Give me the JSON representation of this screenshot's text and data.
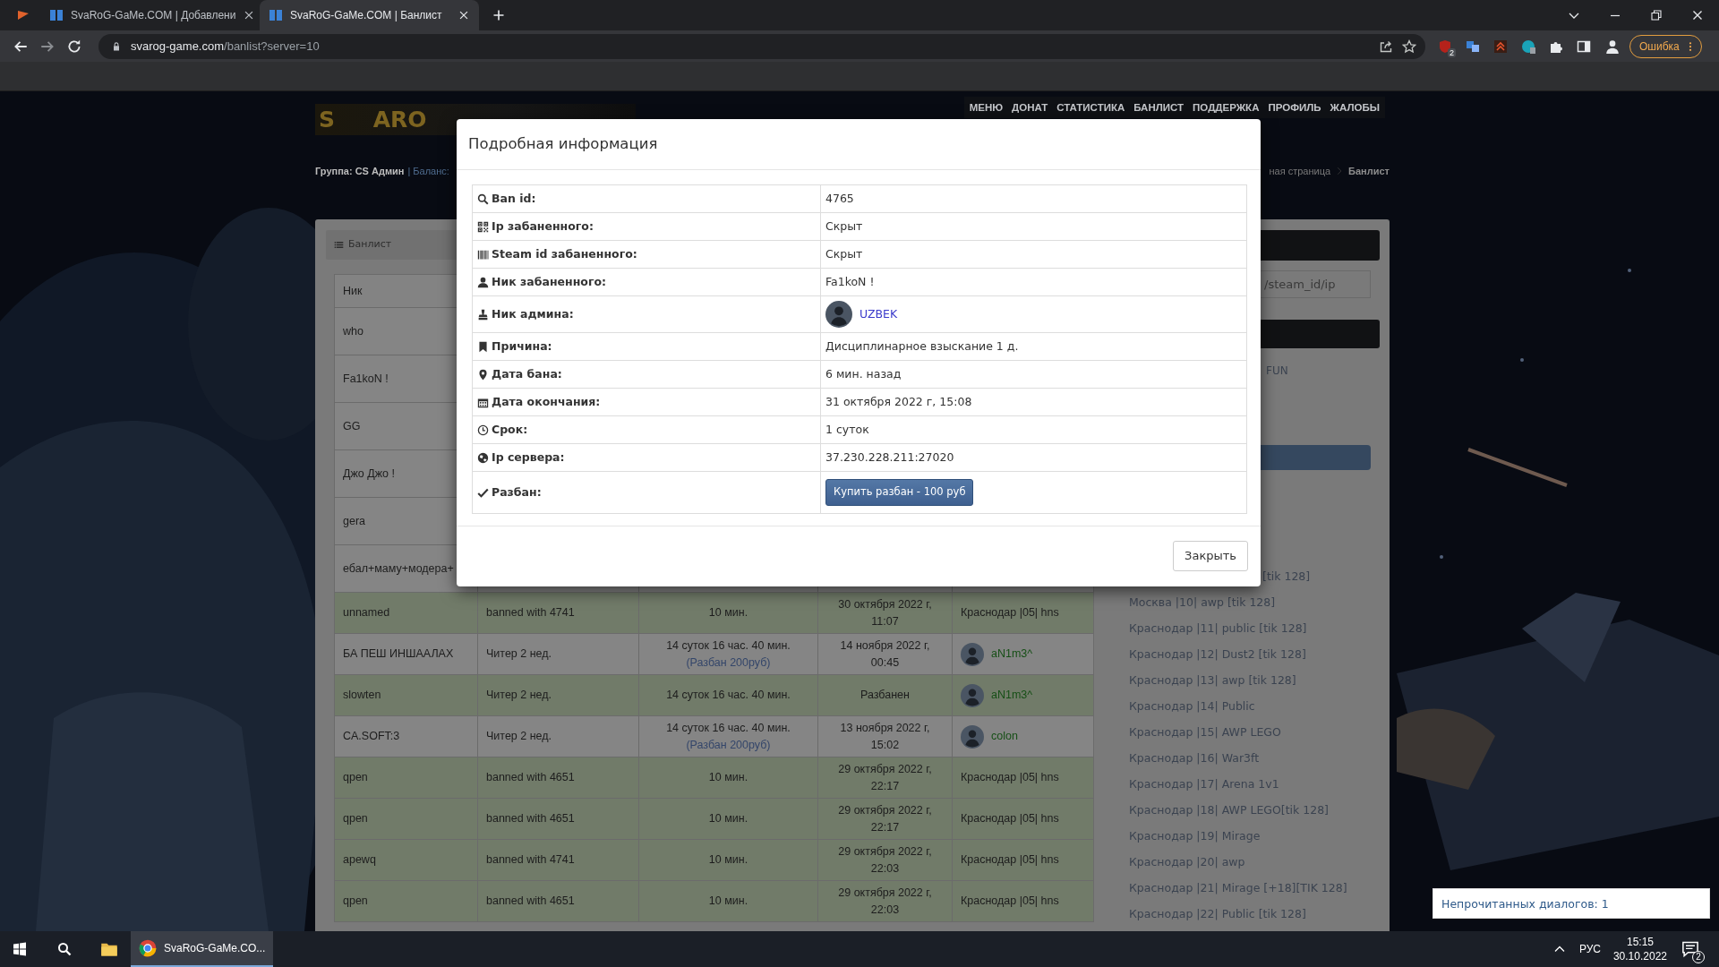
{
  "browser": {
    "tabs": [
      {
        "selected": false
      },
      {
        "title": "SvaRoG-GaMe.COM | Добавлени",
        "selected": false
      },
      {
        "title": "SvaRoG-GaMe.COM | Банлист",
        "selected": true
      }
    ],
    "url_domain": "svarog-game.com",
    "url_path": "/banlist?server=10",
    "extension_badge": "2",
    "profile_button": "Ошибка"
  },
  "site": {
    "logo": "S ARO",
    "nav": [
      "МЕНЮ",
      "ДОНАТ",
      "СТАТИСТИКА",
      "БАНЛИСТ",
      "ПОДДЕРЖКА",
      "ПРОФИЛЬ",
      "ЖАЛОБЫ"
    ],
    "group": "Группа: CS Админ",
    "balance": "| Баланс:",
    "breadcrumbs": [
      "ная страница",
      "Банлист"
    ],
    "panel_title": "Банлист",
    "table": {
      "columns": [
        "Ник"
      ],
      "rows": [
        {
          "nick": "who",
          "highlight": false
        },
        {
          "nick": "Fa1koN !",
          "highlight": false
        },
        {
          "nick": "GG",
          "highlight": false
        },
        {
          "nick": "Джо Джо !",
          "highlight": false
        },
        {
          "nick": "gera",
          "highlight": false
        },
        {
          "nick": "ебал+маму+модера+",
          "highlight": false
        },
        {
          "nick": "unnamed",
          "reason": "banned with 4741",
          "term": "10 мин.",
          "end": "30 октября 2022 г,\n11:07",
          "admin": {
            "kind": "server",
            "text": "Краснодар |05| hns"
          },
          "highlight": true
        },
        {
          "nick": "БА ПЕШ ИНШААЛАХ",
          "reason": "Читер 2 нед.",
          "term": "14 суток 16 час. 40 мин.",
          "unban_link": "(Разбан 200руб)",
          "end": "14 ноября 2022 г,\n00:45",
          "admin": {
            "kind": "admin",
            "text": "aN1m3^"
          },
          "highlight": false
        },
        {
          "nick": "slowten",
          "reason": "Читер 2 нед.",
          "term": "14 суток 16 час. 40 мин.",
          "end": "Разбанен",
          "admin": {
            "kind": "admin",
            "text": "aN1m3^"
          },
          "highlight": true
        },
        {
          "nick": "CA.SOFT:3",
          "reason": "Читер 2 нед.",
          "term": "14 суток 16 час. 40 мин.",
          "unban_link": "(Разбан 200руб)",
          "end": "13 ноября 2022 г,\n15:02",
          "admin": {
            "kind": "admin",
            "text": "colon"
          },
          "highlight": false
        },
        {
          "nick": "qpen",
          "reason": "banned with 4651",
          "term": "10 мин.",
          "end": "29 октября 2022 г,\n22:17",
          "admin": {
            "kind": "server",
            "text": "Краснодар |05| hns"
          },
          "highlight": true
        },
        {
          "nick": "qpen",
          "reason": "banned with 4651",
          "term": "10 мин.",
          "end": "29 октября 2022 г,\n22:17",
          "admin": {
            "kind": "server",
            "text": "Краснодар |05| hns"
          },
          "highlight": true
        },
        {
          "nick": "apewq",
          "reason": "banned with 4741",
          "term": "10 мин.",
          "end": "29 октября 2022 г,\n22:03",
          "admin": {
            "kind": "server",
            "text": "Краснодар |05| hns"
          },
          "highlight": true
        },
        {
          "nick": "qpen",
          "reason": "banned with 4651",
          "term": "10 мин.",
          "end": "29 октября 2022 г,\n22:03",
          "admin": {
            "kind": "server",
            "text": "Краснодар |05| hns"
          },
          "highlight": true
        }
      ]
    },
    "sidebar": {
      "search_placeholder": "/steam_id/ip",
      "filter_text": "FUN",
      "servers": [
        {
          "label": "[tik 128]",
          "kind": "fragment"
        },
        {
          "label": "Москва |10| awp [tik 128]",
          "kind": "full"
        },
        {
          "label": "Краснодар |11| public [tik 128]",
          "kind": "full"
        },
        {
          "label": "Краснодар |12| Dust2 [tik 128]",
          "kind": "full"
        },
        {
          "label": "Краснодар |13| awp [tik 128]",
          "kind": "full"
        },
        {
          "label": "Краснодар |14| Public",
          "kind": "full"
        },
        {
          "label": "Краснодар |15| AWP LEGO",
          "kind": "full"
        },
        {
          "label": "Краснодар |16| War3ft",
          "kind": "full"
        },
        {
          "label": "Краснодар |17| Arena 1v1",
          "kind": "full"
        },
        {
          "label": "Краснодар |18| AWP LEGO[tik 128]",
          "kind": "full"
        },
        {
          "label": "Краснодар |19| Mirage",
          "kind": "full"
        },
        {
          "label": "Краснодар |20| awp",
          "kind": "full"
        },
        {
          "label": "Краснодар |21| Mirage [+18][TIK 128]",
          "kind": "full"
        },
        {
          "label": "Краснодар |22| Public [tik 128]",
          "kind": "full"
        }
      ]
    }
  },
  "modal": {
    "title": "Подробная информация",
    "rows": [
      {
        "label": "Ban id:",
        "kind": "text",
        "value": "4765"
      },
      {
        "label": "Ip забаненного:",
        "kind": "text",
        "value": "Скрыт"
      },
      {
        "label": "Steam id забаненного:",
        "kind": "text",
        "value": "Скрыт"
      },
      {
        "label": "Ник забаненного:",
        "kind": "text",
        "value": "Fa1koN !"
      },
      {
        "label": "Ник админа:",
        "kind": "admin",
        "value": "UZBEK"
      },
      {
        "label": "Причина:",
        "kind": "text",
        "value": "Дисциплинарное взыскание 1 д."
      },
      {
        "label": "Дата бана:",
        "kind": "text",
        "value": "6 мин. назад"
      },
      {
        "label": "Дата окончания:",
        "kind": "text",
        "value": "31 октября 2022 г, 15:08"
      },
      {
        "label": "Срок:",
        "kind": "text",
        "value": "1 суток"
      },
      {
        "label": "Ip сервера:",
        "kind": "text",
        "value": "37.230.228.211:27020"
      },
      {
        "label": "Разбан:",
        "kind": "button",
        "value": "Купить разбан - 100 руб"
      }
    ],
    "close_button": "Закрыть"
  },
  "toast": "Непрочитанных диалогов: 1",
  "taskbar": {
    "task": "SvaRoG-GaMe.CO...",
    "language": "РУС",
    "time": "15:15",
    "date": "30.10.2022",
    "notification_count": "2"
  }
}
